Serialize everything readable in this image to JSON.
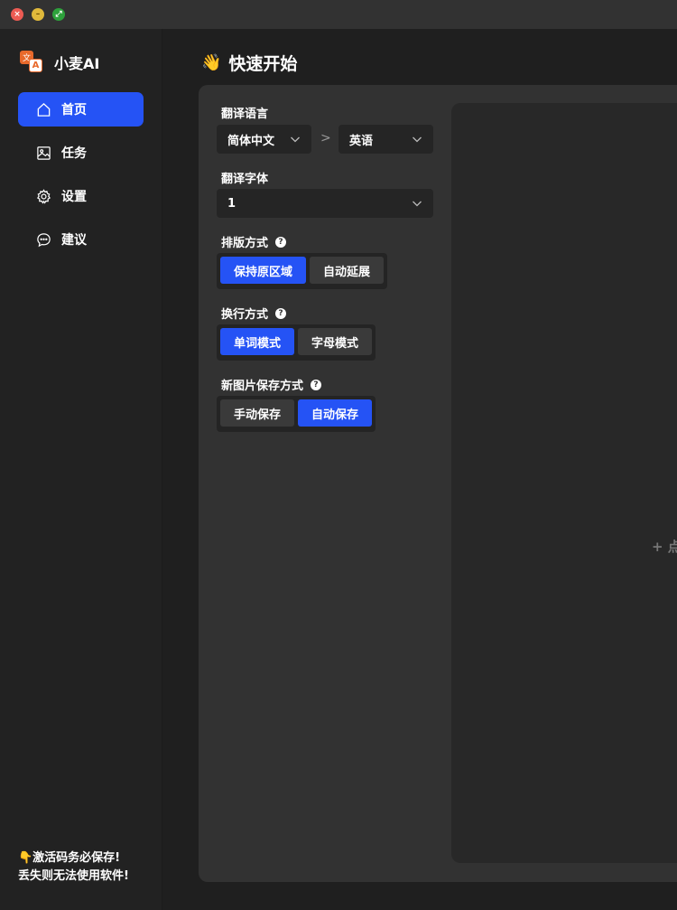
{
  "window": {
    "controls": [
      "close-icon",
      "minimize-icon",
      "maximize-icon"
    ]
  },
  "sidebar": {
    "brand": {
      "name": "小麦AI",
      "logo_top": "文",
      "logo_bottom": "A"
    },
    "items": [
      {
        "label": "首页",
        "icon": "home-icon",
        "active": true
      },
      {
        "label": "任务",
        "icon": "image-icon",
        "active": false
      },
      {
        "label": "设置",
        "icon": "gear-icon",
        "active": false
      },
      {
        "label": "建议",
        "icon": "chat-icon",
        "active": false
      }
    ],
    "notice_line1": "👇激活码务必保存!",
    "notice_line2": "丢失则无法使用软件!"
  },
  "main": {
    "title_emoji": "👋",
    "title": "快速开始",
    "translate_language": {
      "label": "翻译语言",
      "source": "简体中文",
      "separator": ">",
      "target": "英语"
    },
    "translate_font": {
      "label": "翻译字体",
      "value": "1"
    },
    "layout_mode": {
      "label": "排版方式",
      "options": [
        "保持原区域",
        "自动延展"
      ],
      "selected": 0
    },
    "wrap_mode": {
      "label": "换行方式",
      "options": [
        "单词模式",
        "字母模式"
      ],
      "selected": 0
    },
    "save_mode": {
      "label": "新图片保存方式",
      "options": [
        "手动保存",
        "自动保存"
      ],
      "selected": 1
    },
    "drop_area": {
      "text": "+ 点"
    }
  },
  "colors": {
    "accent": "#2553f5",
    "sidebar_bg": "#222222",
    "panel_bg": "#323232",
    "titlebar_bg": "#323232"
  }
}
